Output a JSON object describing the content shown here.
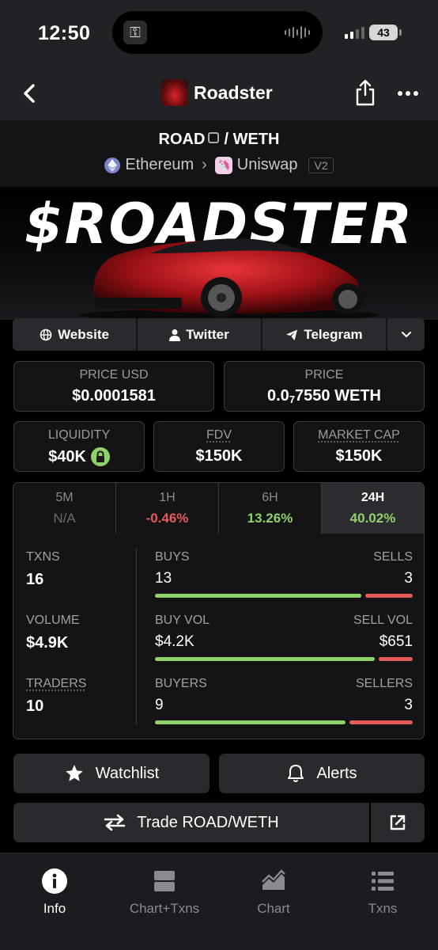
{
  "status_bar": {
    "time": "12:50",
    "battery": "43"
  },
  "header": {
    "title": "Roadster"
  },
  "pair": {
    "base": "ROAD",
    "separator": "/",
    "quote": "WETH",
    "chain": "Ethereum",
    "dex": "Uniswap",
    "version": "V2"
  },
  "banner": {
    "title": "$ROADSTER"
  },
  "links": {
    "website": "Website",
    "twitter": "Twitter",
    "telegram": "Telegram"
  },
  "stats": {
    "price_usd_label": "PRICE USD",
    "price_usd": "$0.0001581",
    "price_label": "PRICE",
    "price_prefix": "0.0",
    "price_sub": "7",
    "price_rest": "7550 WETH",
    "liquidity_label": "LIQUIDITY",
    "liquidity": "$40K",
    "fdv_label": "FDV",
    "fdv": "$150K",
    "mcap_label": "MARKET CAP",
    "mcap": "$150K"
  },
  "timeframes": [
    {
      "label": "5M",
      "value": "N/A"
    },
    {
      "label": "1H",
      "value": "-0.46%"
    },
    {
      "label": "6H",
      "value": "13.26%"
    },
    {
      "label": "24H",
      "value": "40.02%"
    }
  ],
  "txns": {
    "txns_label": "TXNS",
    "txns": "16",
    "volume_label": "VOLUME",
    "volume": "$4.9K",
    "traders_label": "TRADERS",
    "traders": "10",
    "buys_label": "BUYS",
    "buys": "13",
    "sells_label": "SELLS",
    "sells": "3",
    "buy_vol_label": "BUY VOL",
    "buy_vol": "$4.2K",
    "sell_vol_label": "SELL VOL",
    "sell_vol": "$651",
    "buyers_label": "BUYERS",
    "buyers": "9",
    "sellers_label": "SELLERS",
    "sellers": "3",
    "buys_ratio": 0.8125,
    "buy_vol_ratio": 0.866,
    "buyers_ratio": 0.75
  },
  "actions": {
    "watchlist": "Watchlist",
    "alerts": "Alerts",
    "trade": "Trade ROAD/WETH"
  },
  "tabs": {
    "info": "Info",
    "chart_txns": "Chart+Txns",
    "chart": "Chart",
    "txns": "Txns"
  },
  "colors": {
    "green": "#8fd16a",
    "red": "#e65b5b",
    "background": "#141416"
  }
}
